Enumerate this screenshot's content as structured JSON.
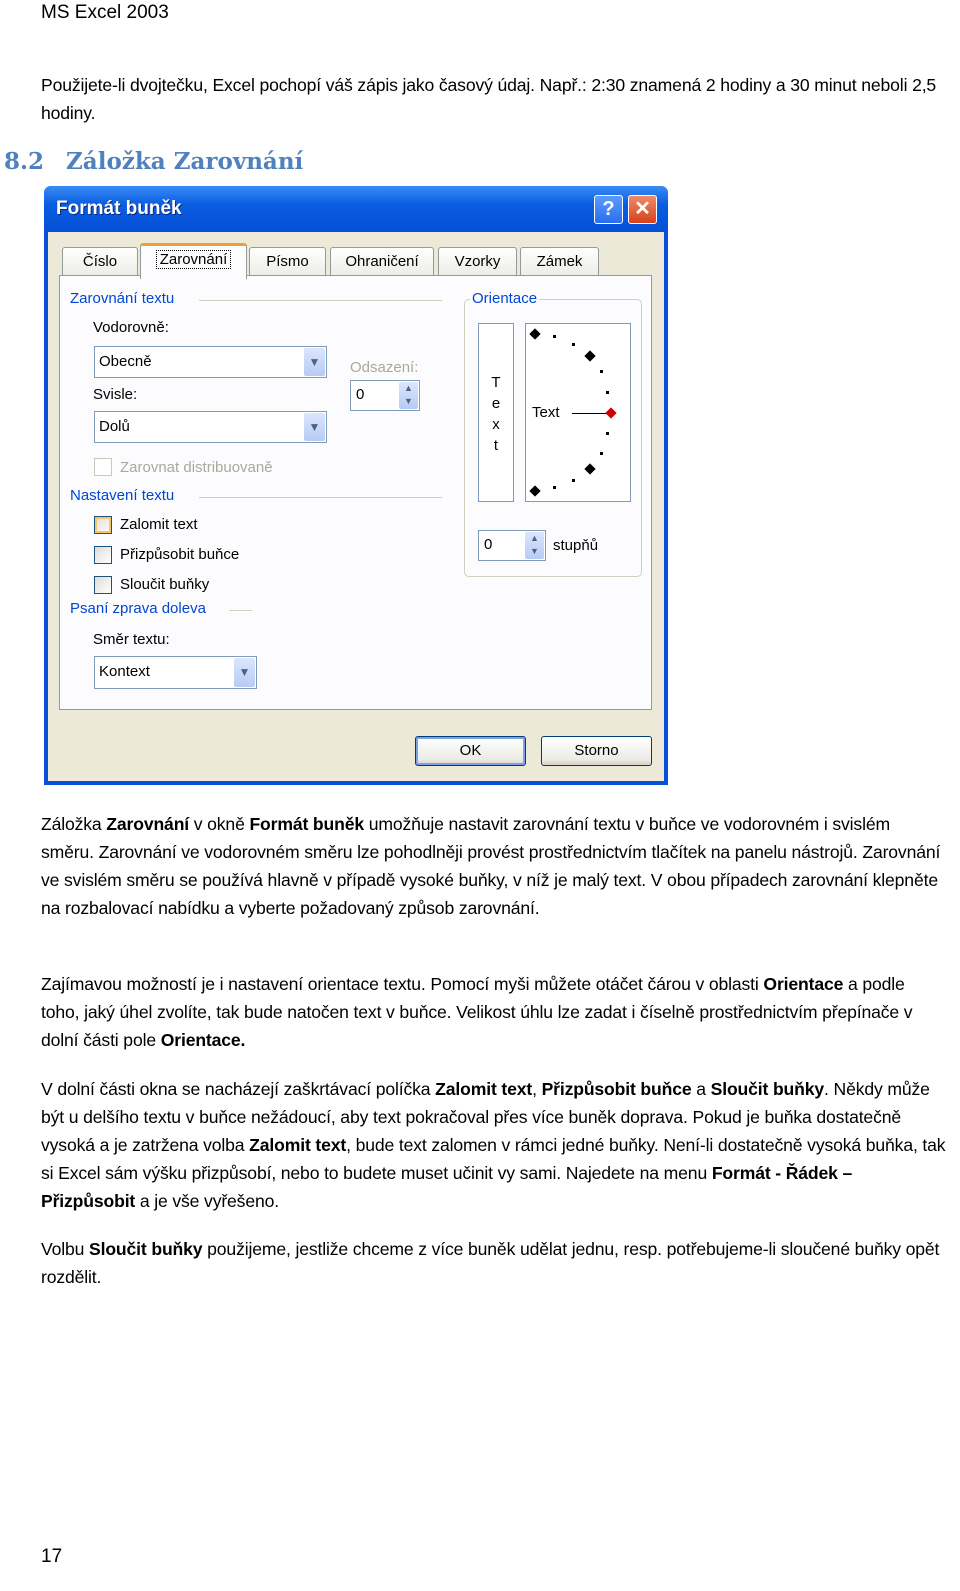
{
  "header": "MS Excel 2003",
  "intro": "Použijete-li dvojtečku, Excel pochopí váš zápis jako časový údaj. Např.: 2:30 znamená 2 hodiny a 30 minut neboli 2,5 hodiny.",
  "heading": {
    "number": "8.2",
    "title": "Záložka Zarovnání"
  },
  "dialog": {
    "title": "Formát buněk",
    "help_glyph": "?",
    "close_glyph": "✕",
    "tabs": [
      {
        "label": "Číslo"
      },
      {
        "label": "Zarovnání",
        "selected": true
      },
      {
        "label": "Písmo"
      },
      {
        "label": "Ohraničení"
      },
      {
        "label": "Vzorky"
      },
      {
        "label": "Zámek"
      }
    ],
    "text_alignment_group": "Zarovnání textu",
    "horizontal_label": "Vodorovně:",
    "horizontal_value": "Obecně",
    "indent_label": "Odsazení:",
    "indent_value": "0",
    "vertical_label": "Svisle:",
    "vertical_value": "Dolů",
    "distributed_label": "Zarovnat distribuovaně",
    "text_control_group": "Nastavení textu",
    "checkboxes": [
      {
        "label": "Zalomit text",
        "checked": false
      },
      {
        "label": "Přizpůsobit buňce",
        "checked": false
      },
      {
        "label": "Sloučit buňky",
        "checked": false
      }
    ],
    "rtl_group": "Psaní zprava doleva",
    "direction_label": "Směr textu:",
    "direction_value": "Kontext",
    "orientation_group": "Orientace",
    "vertical_text": [
      "T",
      "e",
      "x",
      "t"
    ],
    "dial_text": "Text",
    "degrees_value": "0",
    "degrees_label": "stupňů",
    "ok": "OK",
    "cancel": "Storno",
    "colors": {
      "titlebar": "#0a5de0",
      "group_label": "#0046d5",
      "dial_marker": "#d00000"
    }
  },
  "paragraphs": [
    [
      {
        "t": "Záložka "
      },
      {
        "t": "Zarovnání",
        "b": true
      },
      {
        "t": " v okně "
      },
      {
        "t": "Formát buněk",
        "b": true
      },
      {
        "t": " umožňuje nastavit zarovnání textu v buňce ve vodorovném i svislém směru. Zarovnání ve vodorovném směru lze pohodlněji provést prostřednictvím tlačítek na panelu nástrojů. Zarovnání ve svislém směru se používá hlavně v případě vysoké buňky, v níž je malý text. V obou případech zarovnání klepněte na rozbalovací nabídku a vyberte požadovaný způsob zarovnání."
      }
    ],
    [
      {
        "t": "Zajímavou možností je i nastavení orientace textu. Pomocí myši můžete otáčet čárou v oblasti "
      },
      {
        "t": "Orientace",
        "b": true
      },
      {
        "t": " a podle toho, jaký úhel zvolíte, tak bude natočen text v buňce. Velikost úhlu lze zadat i číselně prostřednictvím přepínače v dolní části pole "
      },
      {
        "t": "Orientace.",
        "b": true
      }
    ],
    [
      {
        "t": "V dolní části okna se nacházejí zaškrtávací políčka "
      },
      {
        "t": "Zalomit text",
        "b": true
      },
      {
        "t": ", "
      },
      {
        "t": "Přizpůsobit buňce",
        "b": true
      },
      {
        "t": " a "
      },
      {
        "t": "Sloučit buňky",
        "b": true
      },
      {
        "t": ". Někdy může být u delšího textu v buňce nežádoucí, aby text pokračoval přes více buněk doprava. Pokud je buňka dostatečně vysoká a je zatržena volba "
      },
      {
        "t": "Zalomit text",
        "b": true
      },
      {
        "t": ", bude text zalomen v rámci jedné buňky. Není-li dostatečně vysoká buňka, tak si Excel sám výšku přizpůsobí, nebo to budete muset učinit vy sami. Najedete na menu "
      },
      {
        "t": "Formát - Řádek – Přizpůsobit",
        "b": true
      },
      {
        "t": " a je vše vyřešeno."
      }
    ],
    [
      {
        "t": "Volbu "
      },
      {
        "t": "Sloučit buňky",
        "b": true
      },
      {
        "t": " použijeme, jestliže chceme z více buněk udělat jednu, resp. potřebujeme-li sloučené buňky opět rozdělit."
      }
    ]
  ],
  "page_number": "17"
}
